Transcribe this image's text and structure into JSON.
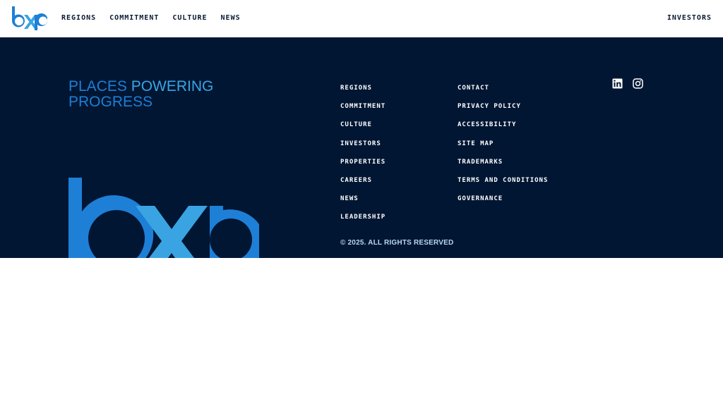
{
  "header": {
    "logo_alt": "bxp",
    "nav": [
      {
        "label": "REGIONS"
      },
      {
        "label": "COMMITMENT"
      },
      {
        "label": "CULTURE"
      },
      {
        "label": "NEWS"
      }
    ],
    "right_link": "INVESTORS"
  },
  "footer": {
    "tagline": {
      "word1": "PLACES",
      "word2": "POWERING",
      "word3": "PROGRESS"
    },
    "col1": [
      "REGIONS",
      "COMMITMENT",
      "CULTURE",
      "INVESTORS",
      "PROPERTIES",
      "CAREERS",
      "NEWS",
      "LEADERSHIP"
    ],
    "col2": [
      "CONTACT",
      "PRIVACY POLICY",
      "ACCESSIBILITY",
      "SITE MAP",
      "TRADEMARKS",
      "TERMS AND CONDITIONS",
      "GOVERNANCE"
    ],
    "copyright": "© 2025. ALL RIGHTS RESERVED",
    "social": [
      {
        "icon": "linkedin-icon"
      },
      {
        "icon": "instagram-icon"
      }
    ]
  },
  "colors": {
    "footer_bg": "#011633",
    "brand_blue": "#1e7fd6",
    "brand_light_blue": "#3aa4e3",
    "nav_text": "#0a1a33"
  }
}
